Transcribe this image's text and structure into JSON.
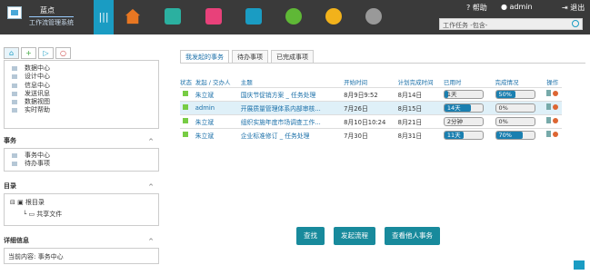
{
  "logo": {
    "line1": "蓝点",
    "line2": "工作流管理系统"
  },
  "top": {
    "help": "帮助",
    "user": "admin",
    "logout": "退出",
    "search_placeholder": "工作任务  -包含-"
  },
  "left": {
    "items": [
      "数据中心",
      "设计中心",
      "信息中心",
      "发送讯息",
      "数据视图",
      "实时帮助"
    ],
    "sec1": "事务",
    "sec1_items": [
      "事务中心",
      "待办事项"
    ],
    "sec2": "目录",
    "root": "根目录",
    "shared": "共享文件",
    "sec3": "详细信息",
    "current_label": "当前内容:",
    "current_value": "事务中心"
  },
  "tabs": [
    "我发起的事务",
    "待办事项",
    "已完成事项"
  ],
  "headers": [
    "状态",
    "发起 / 交办人",
    "主题",
    "开始时间",
    "计划完成时间",
    "已用时",
    "完成情况",
    "操作"
  ],
  "rows": [
    {
      "who": "朱立斌",
      "subject": "国庆节促销方案 _ 任务处理",
      "start": "8月9日9:52",
      "end": "8月14日",
      "used": "1天",
      "used_fill": 0.1,
      "done": "50%",
      "done_fill": 0.5
    },
    {
      "who": "admin",
      "subject": "开展质量管理体系内部审核...",
      "start": "7月26日",
      "end": "8月15日",
      "used": "14天",
      "used_fill": 0.7,
      "done": "0%",
      "done_fill": 0
    },
    {
      "who": "朱立斌",
      "subject": "组织实施年度市场调查工作...",
      "start": "8月10日10:24",
      "end": "8月21日",
      "used": "2分钟",
      "used_fill": 0,
      "done": "0%",
      "done_fill": 0
    },
    {
      "who": "朱立斌",
      "subject": "企业标准修订 _ 任务处理",
      "start": "7月30日",
      "end": "8月31日",
      "used": "11天",
      "used_fill": 0.5,
      "done": "70%",
      "done_fill": 0.7
    }
  ],
  "buttons": [
    "查找",
    "发起流程",
    "查看他人事务"
  ]
}
